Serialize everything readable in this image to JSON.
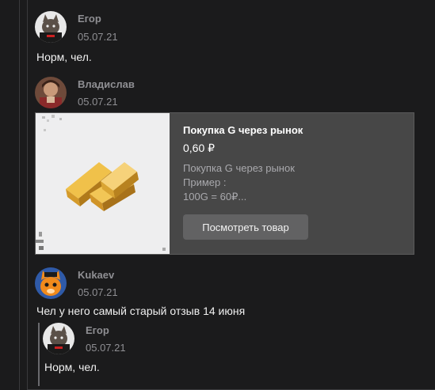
{
  "comments": [
    {
      "author": "Егор",
      "date": "05.07.21",
      "text": "Норм, чел."
    },
    {
      "author": "Владислав",
      "date": "05.07.21"
    },
    {
      "author": "Kukaev",
      "date": "05.07.21",
      "text": "Чел у него самый старый отзыв 14 июня"
    }
  ],
  "product_card": {
    "title": "Покупка G через рынок",
    "price": "0,60 ₽",
    "description_lines": [
      "Покупка G через рынок",
      "Пример :",
      "100G = 60₽..."
    ],
    "button_label": "Посмотреть товар"
  },
  "quoted_comment": {
    "author": "Егор",
    "date": "05.07.21",
    "text": "Норм, чел."
  },
  "colors": {
    "background": "#1b1b1c",
    "card": "#474747",
    "button": "#626263",
    "meta_text": "#8f8f93"
  }
}
